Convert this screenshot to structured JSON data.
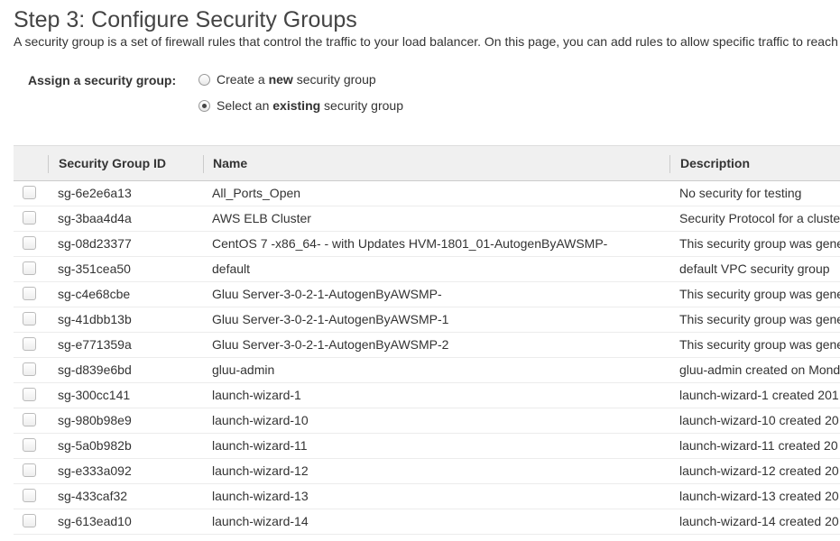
{
  "page": {
    "title": "Step 3: Configure Security Groups",
    "description": "A security group is a set of firewall rules that control the traffic to your load balancer. On this page, you can add rules to allow specific traffic to reach"
  },
  "assign": {
    "label": "Assign a security group:",
    "options": [
      {
        "prefix": "Create a ",
        "bold": "new",
        "suffix": " security group",
        "selected": false
      },
      {
        "prefix": "Select an ",
        "bold": "existing",
        "suffix": " security group",
        "selected": true
      }
    ]
  },
  "table": {
    "columns": {
      "id": "Security Group ID",
      "name": "Name",
      "description": "Description"
    },
    "rows": [
      {
        "id": "sg-6e2e6a13",
        "name": "All_Ports_Open",
        "description": "No security for testing"
      },
      {
        "id": "sg-3baa4d4a",
        "name": "AWS ELB Cluster",
        "description": "Security Protocol for a cluste"
      },
      {
        "id": "sg-08d23377",
        "name": "CentOS 7 -x86_64- - with Updates HVM-1801_01-AutogenByAWSMP-",
        "description": "This security group was gene"
      },
      {
        "id": "sg-351cea50",
        "name": "default",
        "description": "default VPC security group"
      },
      {
        "id": "sg-c4e68cbe",
        "name": "Gluu Server-3-0-2-1-AutogenByAWSMP-",
        "description": "This security group was gene"
      },
      {
        "id": "sg-41dbb13b",
        "name": "Gluu Server-3-0-2-1-AutogenByAWSMP-1",
        "description": "This security group was gene"
      },
      {
        "id": "sg-e771359a",
        "name": "Gluu Server-3-0-2-1-AutogenByAWSMP-2",
        "description": "This security group was gene"
      },
      {
        "id": "sg-d839e6bd",
        "name": "gluu-admin",
        "description": "gluu-admin created on Mond"
      },
      {
        "id": "sg-300cc141",
        "name": "launch-wizard-1",
        "description": "launch-wizard-1 created 201"
      },
      {
        "id": "sg-980b98e9",
        "name": "launch-wizard-10",
        "description": "launch-wizard-10 created 20"
      },
      {
        "id": "sg-5a0b982b",
        "name": "launch-wizard-11",
        "description": "launch-wizard-11 created 20"
      },
      {
        "id": "sg-e333a092",
        "name": "launch-wizard-12",
        "description": "launch-wizard-12 created 20"
      },
      {
        "id": "sg-433caf32",
        "name": "launch-wizard-13",
        "description": "launch-wizard-13 created 20"
      },
      {
        "id": "sg-613ead10",
        "name": "launch-wizard-14",
        "description": "launch-wizard-14 created 20"
      }
    ]
  }
}
